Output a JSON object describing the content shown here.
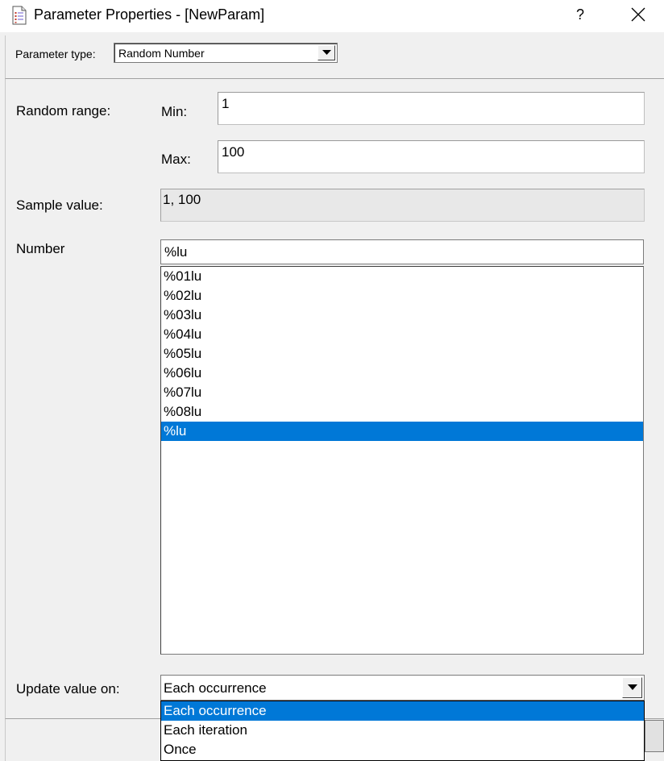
{
  "window": {
    "title": "Parameter Properties - [NewParam]",
    "help": "?"
  },
  "parameter_type": {
    "label": "Parameter type:",
    "value": "Random Number"
  },
  "random_range": {
    "label": "Random range:",
    "min_label": "Min:",
    "min_value": "1",
    "max_label": "Max:",
    "max_value": "100"
  },
  "sample": {
    "label": "Sample value:",
    "value": "1, 100"
  },
  "number": {
    "label": "Number",
    "format_value": "%lu",
    "format_options": [
      "%01lu",
      "%02lu",
      "%03lu",
      "%04lu",
      "%05lu",
      "%06lu",
      "%07lu",
      "%08lu",
      "%lu"
    ],
    "selected_option": "%lu"
  },
  "update": {
    "label": "Update value on:",
    "value": "Each occurrence",
    "options": [
      "Each occurrence",
      "Each iteration",
      "Once"
    ],
    "selected_option": "Each occurrence"
  },
  "colors": {
    "selection": "#0078d7",
    "background": "#f0f0f0"
  }
}
